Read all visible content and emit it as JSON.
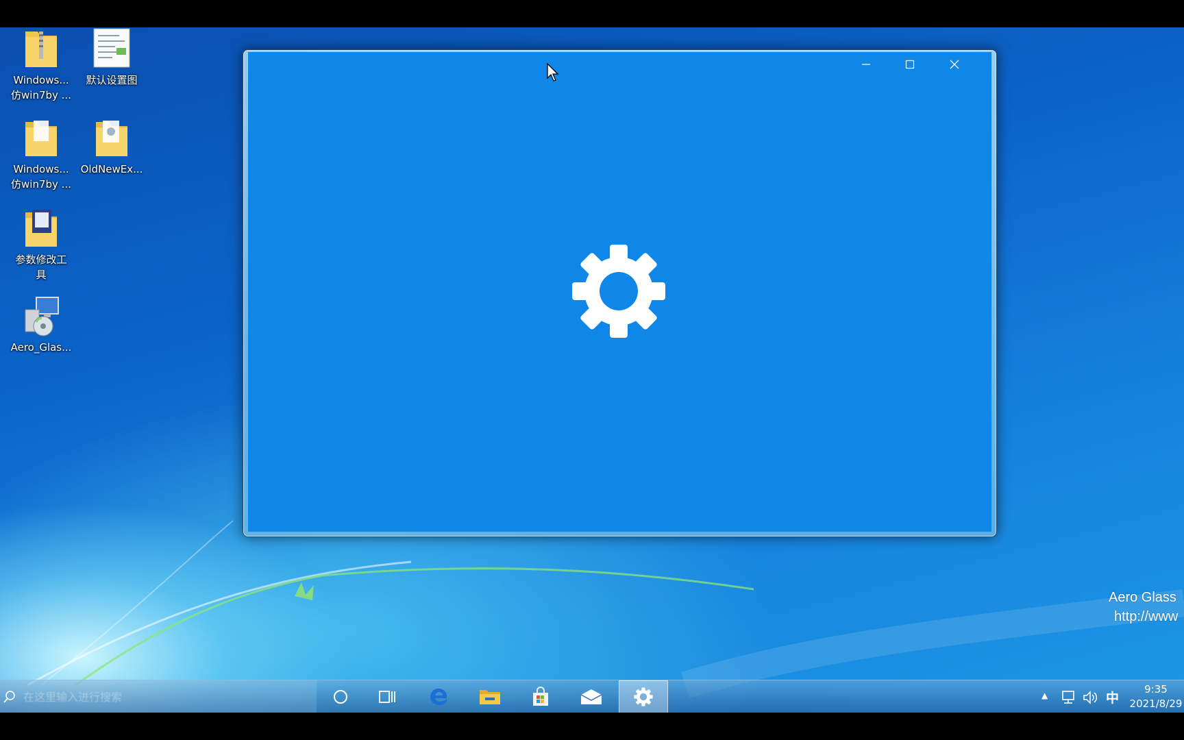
{
  "desktop": {
    "icons": [
      {
        "label": "Windows...\n仿win7by ...",
        "icon": "zip-folder-icon"
      },
      {
        "label": "默认设置图",
        "icon": "document-image-icon"
      },
      {
        "label": "Windows...\n仿win7by ...",
        "icon": "folder-icon"
      },
      {
        "label": "OldNewEx...",
        "icon": "folder-icon"
      },
      {
        "label": "参数修改工\n具",
        "icon": "folder-icon"
      },
      {
        "label": "Aero_Glas...",
        "icon": "installer-icon"
      }
    ],
    "watermark": {
      "line1": "Aero Glass",
      "line2": "http://www"
    }
  },
  "window": {
    "accent_color": "#0e87e8",
    "center_icon": "gear-icon",
    "controls": {
      "minimize": "minimize-icon",
      "maximize": "maximize-icon",
      "close": "close-icon"
    }
  },
  "taskbar": {
    "search": {
      "placeholder": "在这里输入进行搜索",
      "icon": "search-icon"
    },
    "buttons": [
      {
        "name": "cortana",
        "icon": "circle-icon"
      },
      {
        "name": "task-view",
        "icon": "task-view-icon"
      },
      {
        "name": "edge",
        "icon": "edge-icon"
      },
      {
        "name": "file-explorer",
        "icon": "folder-icon"
      },
      {
        "name": "store",
        "icon": "store-icon"
      },
      {
        "name": "mail",
        "icon": "mail-icon"
      },
      {
        "name": "settings",
        "icon": "gear-icon",
        "active": true
      }
    ],
    "tray": {
      "chevron": "▲",
      "ime": "中",
      "time": "9:35",
      "date": "2021/8/29"
    }
  }
}
